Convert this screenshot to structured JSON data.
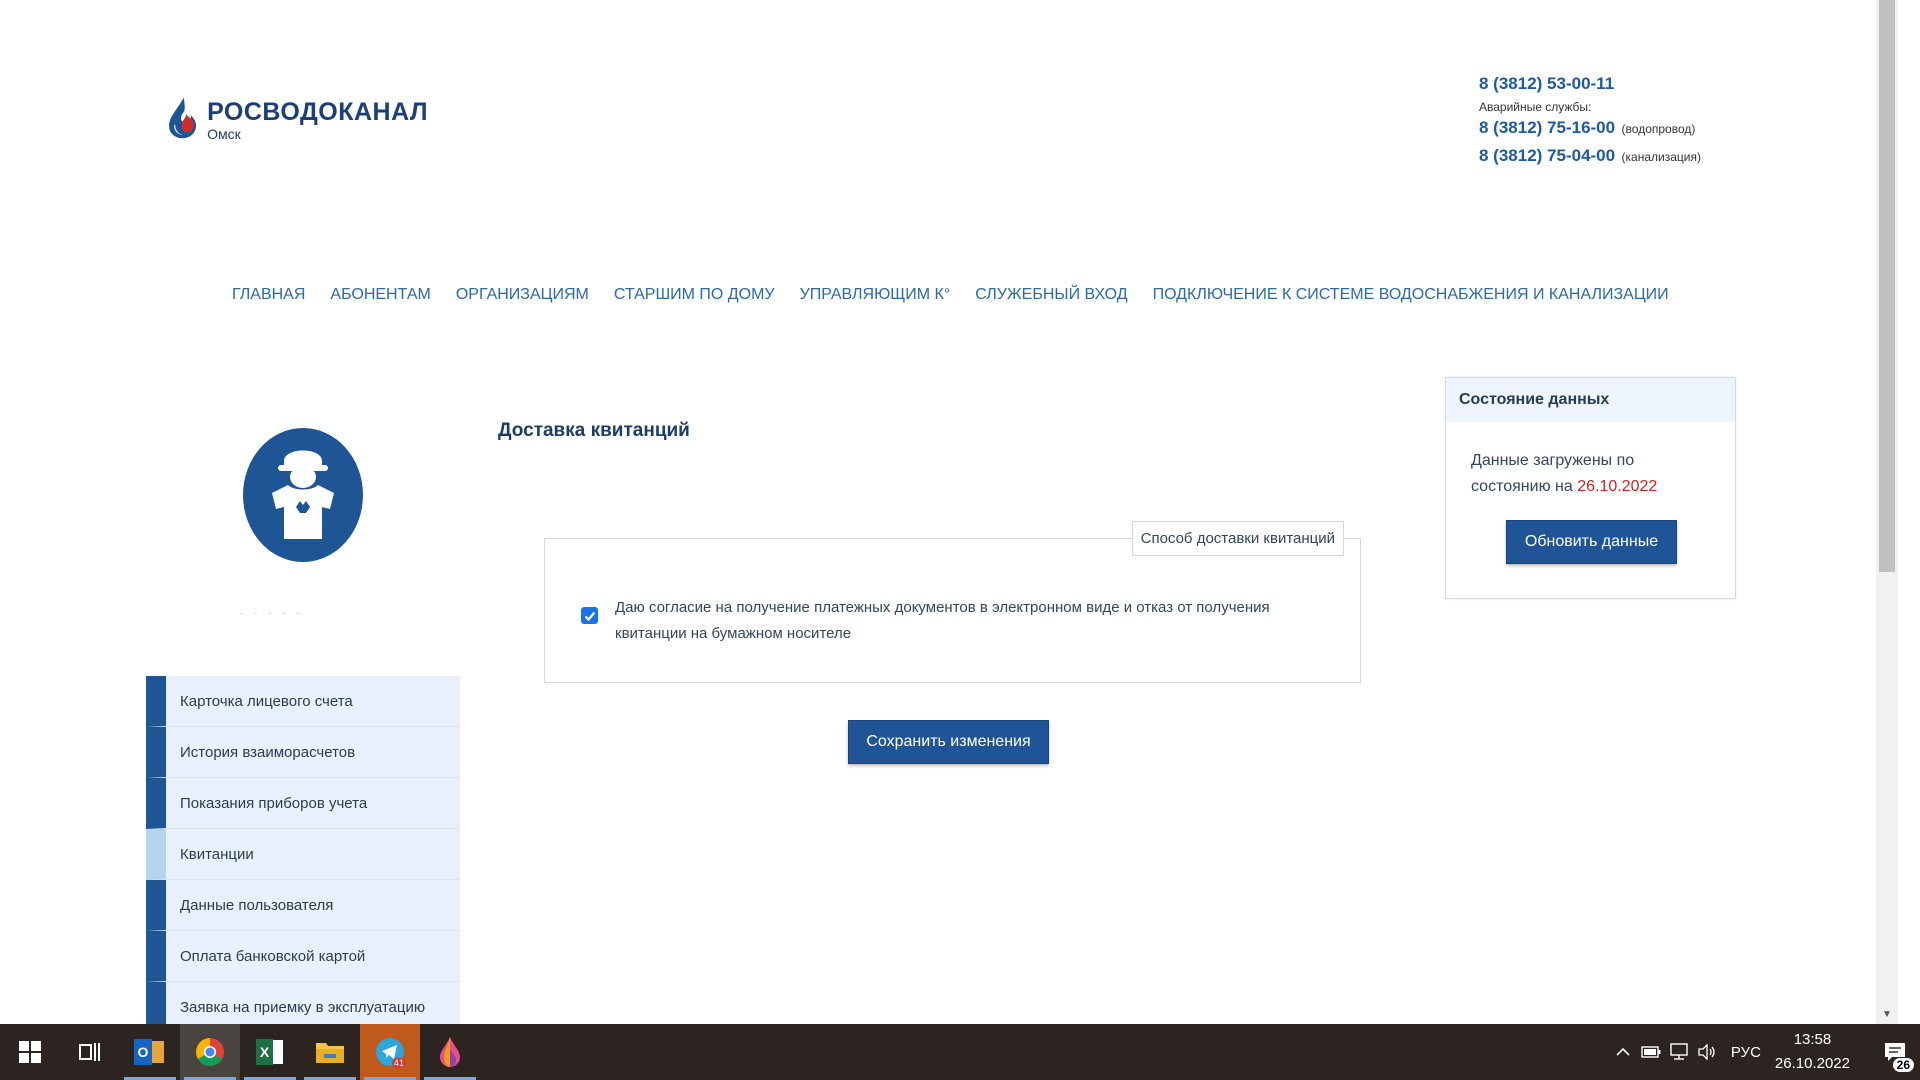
{
  "logo": {
    "name": "РОСВОДОКАНАЛ",
    "city": "Омск"
  },
  "contacts": {
    "main_phone": "8 (3812) 53-00-11",
    "emergency_label": "Аварийные службы:",
    "water_phone": "8 (3812) 75-16-00",
    "water_note": "(водопровод)",
    "sewer_phone": "8 (3812) 75-04-00",
    "sewer_note": "(канализация)"
  },
  "nav": [
    "ГЛАВНАЯ",
    "АБОНЕНТАМ",
    "ОРГАНИЗАЦИЯМ",
    "СТАРШИМ ПО ДОМУ",
    "УПРАВЛЯЮЩИМ К°",
    "СЛУЖЕБНЫЙ ВХОД",
    "ПОДКЛЮЧЕНИЕ К СИСТЕМЕ ВОДОСНАБЖЕНИЯ И КАНАЛИЗАЦИИ"
  ],
  "side_menu": [
    "Карточка лицевого счета",
    "История взаиморасчетов",
    "Показания приборов учета",
    "Квитанции",
    "Данные пользователя",
    "Оплата банковской картой",
    "Заявка на приемку в эксплуатацию"
  ],
  "side_menu_active": "Квитанции",
  "main": {
    "title": "Доставка квитанций",
    "legend": "Способ доставки квитанций",
    "consent_text": "Даю согласие на получение платежных документов в электронном виде и отказ от получения квитанции на бумажном носителе",
    "consent_checked": true,
    "save_label": "Сохранить изменения"
  },
  "status": {
    "title": "Состояние данных",
    "text": "Данные загружены по состоянию на",
    "date": "26.10.2022",
    "refresh_label": "Обновить данные"
  },
  "taskbar": {
    "apps": [
      "windows-start",
      "task-view",
      "outlook",
      "chrome",
      "excel",
      "file-explorer",
      "telegram",
      "app-drop"
    ],
    "telegram_badge": "41",
    "lang": "РУС",
    "time": "13:58",
    "date": "26.10.2022",
    "notifications": "26"
  },
  "colors": {
    "brand_blue": "#1f5596",
    "link_blue": "#2b69ad",
    "date_red": "#cc2222"
  }
}
